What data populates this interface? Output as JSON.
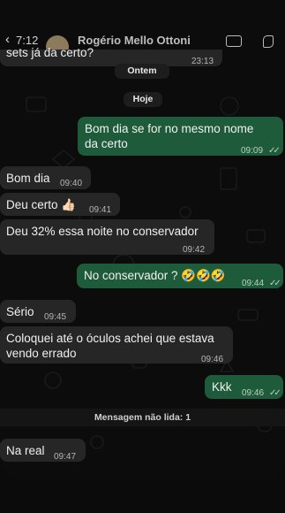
{
  "header": {
    "status_time": "7:12",
    "contact_name": "Rogério Mello Ottoni"
  },
  "date_labels": {
    "yesterday": "Ontem",
    "today": "Hoje"
  },
  "unread_label": "Mensagem não lida: 1",
  "messages": [
    {
      "text": "sets já da certo?",
      "time": "23:13",
      "dir": "in"
    },
    {
      "text": "Bom dia se for no mesmo nome da certo",
      "time": "09:09",
      "dir": "out"
    },
    {
      "text": "Bom dia",
      "time": "09:40",
      "dir": "in"
    },
    {
      "text": "Deu certo 👍🏻",
      "time": "09:41",
      "dir": "in"
    },
    {
      "text": "Deu 32% essa noite no conservador",
      "time": "09:42",
      "dir": "in"
    },
    {
      "text": "No conservador ? 🤣🤣🤣",
      "time": "09:44",
      "dir": "out"
    },
    {
      "text": "Sério",
      "time": "09:45",
      "dir": "in"
    },
    {
      "text": "Coloquei até o óculos achei que estava vendo errado",
      "time": "09:46",
      "dir": "in"
    },
    {
      "text": "Kkk",
      "time": "09:46",
      "dir": "out"
    },
    {
      "text": "Na real",
      "time": "09:47",
      "dir": "in"
    }
  ],
  "icons": [
    "back-chevron-icon",
    "avatar",
    "camera-icon",
    "phone-icon",
    "read-ticks-icon"
  ],
  "colors": {
    "incoming": "#262626",
    "outgoing": "#1e5b3a",
    "background": "#0c0c0c"
  }
}
